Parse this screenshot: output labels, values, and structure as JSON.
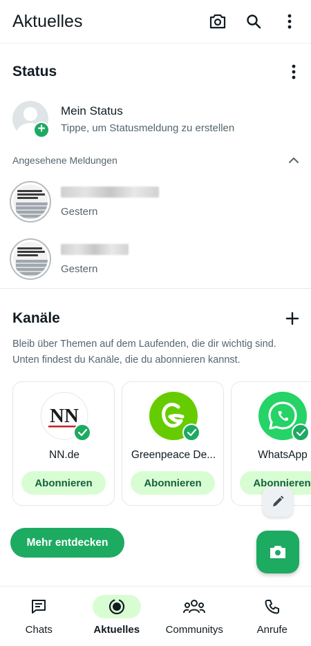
{
  "header": {
    "title": "Aktuelles",
    "icons": [
      "camera-icon",
      "search-icon",
      "more-vert-icon"
    ]
  },
  "status": {
    "title": "Status",
    "my_status": {
      "name": "Mein Status",
      "subtitle": "Tippe, um Statusmeldung zu erstellen"
    },
    "viewed_label": "Angesehene Meldungen",
    "items": [
      {
        "time": "Gestern"
      },
      {
        "time": "Gestern"
      }
    ]
  },
  "channels": {
    "title": "Kanäle",
    "description": "Bleib über Themen auf dem Laufenden, die dir wichtig sind. Unten findest du Kanäle, die du abonnieren kannst.",
    "cards": [
      {
        "name": "NN.de",
        "logo_text": "NN",
        "button": "Abonnieren"
      },
      {
        "name": "Greenpeace De...",
        "button": "Abonnieren"
      },
      {
        "name": "WhatsApp",
        "button": "Abonnieren"
      }
    ],
    "discover_button": "Mehr entdecken"
  },
  "nav": {
    "items": [
      {
        "label": "Chats",
        "icon": "chats-icon",
        "active": false
      },
      {
        "label": "Aktuelles",
        "icon": "updates-icon",
        "active": true
      },
      {
        "label": "Communitys",
        "icon": "communities-icon",
        "active": false
      },
      {
        "label": "Anrufe",
        "icon": "calls-icon",
        "active": false
      }
    ]
  },
  "colors": {
    "accent": "#1daa61",
    "accent_light": "#d9fdd3",
    "text_primary": "#111b21",
    "text_secondary": "#54656f"
  }
}
